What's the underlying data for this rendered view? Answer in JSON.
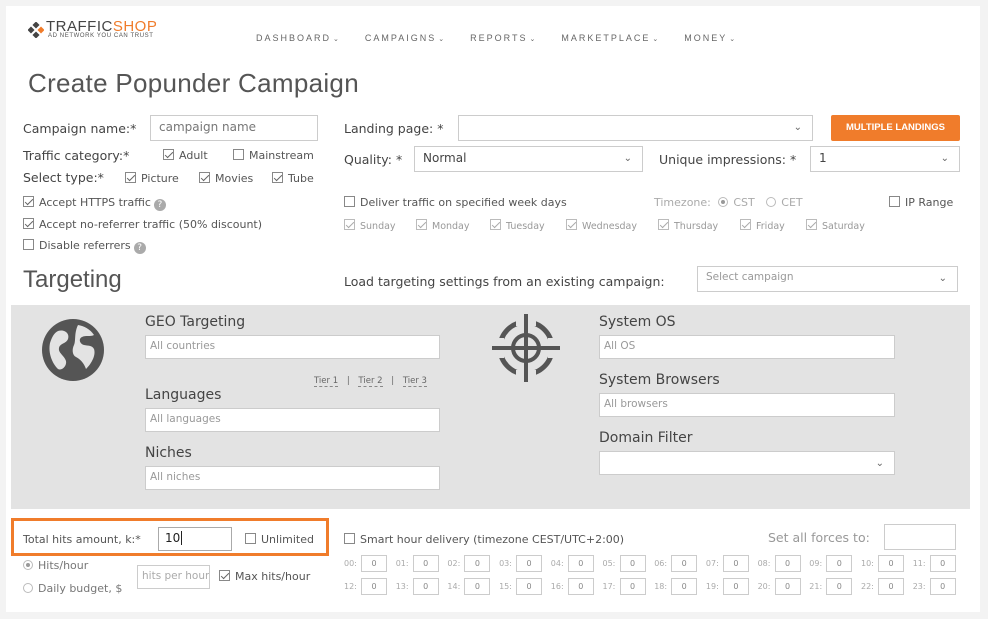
{
  "brand": {
    "name_part1": "TRAFFIC",
    "name_part2": "SHOP",
    "tagline": "AD NETWORK YOU CAN TRUST",
    "accent_color": "#f07c2b"
  },
  "nav": [
    {
      "label": "DASHBOARD",
      "icon": "chevron-down-icon"
    },
    {
      "label": "CAMPAIGNS",
      "icon": "chevron-down-icon"
    },
    {
      "label": "REPORTS",
      "icon": "chevron-down-icon"
    },
    {
      "label": "MARKETPLACE",
      "icon": "chevron-down-icon"
    },
    {
      "label": "MONEY",
      "icon": "chevron-down-icon"
    }
  ],
  "page_title": "Create Popunder Campaign",
  "form": {
    "campaign_name_label": "Campaign name:*",
    "campaign_name_placeholder": "campaign name",
    "landing_page_label": "Landing page: *",
    "landing_page_value": "",
    "multiple_landings_button": "MULTIPLE LANDINGS",
    "traffic_category_label": "Traffic category:*",
    "traffic_categories": [
      {
        "label": "Adult",
        "checked": true
      },
      {
        "label": "Mainstream",
        "checked": false
      }
    ],
    "quality_label": "Quality: *",
    "quality_value": "Normal",
    "unique_impressions_label": "Unique impressions: *",
    "unique_impressions_value": "1",
    "select_type_label": "Select type:*",
    "types": [
      {
        "label": "Picture",
        "checked": true
      },
      {
        "label": "Movies",
        "checked": true
      },
      {
        "label": "Tube",
        "checked": true
      }
    ],
    "accept_https": {
      "label": "Accept HTTPS traffic",
      "checked": true
    },
    "accept_noreferrer": {
      "label": "Accept no-referrer traffic (50% discount)",
      "checked": true
    },
    "disable_referrers": {
      "label": "Disable referrers",
      "checked": false
    },
    "deliver_week_days": {
      "label": "Deliver traffic on specified week days",
      "checked": false
    },
    "timezone_label": "Timezone:",
    "timezones": [
      {
        "label": "CST",
        "selected": true
      },
      {
        "label": "CET",
        "selected": false
      }
    ],
    "ip_range": {
      "label": "IP Range",
      "checked": false
    },
    "week_days": [
      {
        "label": "Sunday",
        "checked": true
      },
      {
        "label": "Monday",
        "checked": true
      },
      {
        "label": "Tuesday",
        "checked": true
      },
      {
        "label": "Wednesday",
        "checked": true
      },
      {
        "label": "Thursday",
        "checked": true
      },
      {
        "label": "Friday",
        "checked": true
      },
      {
        "label": "Saturday",
        "checked": true
      }
    ]
  },
  "targeting": {
    "heading": "Targeting",
    "load_label": "Load targeting settings from an existing campaign:",
    "load_placeholder": "Select campaign",
    "geo_label": "GEO Targeting",
    "geo_placeholder": "All countries",
    "tiers": [
      "Tier 1",
      "Tier 2",
      "Tier 3"
    ],
    "tier_separator": "|",
    "languages_label": "Languages",
    "languages_placeholder": "All languages",
    "niches_label": "Niches",
    "niches_placeholder": "All niches",
    "os_label": "System OS",
    "os_placeholder": "All OS",
    "browsers_label": "System Browsers",
    "browsers_placeholder": "All browsers",
    "domain_filter_label": "Domain Filter",
    "domain_filter_value": ""
  },
  "delivery": {
    "total_hits_label": "Total hits amount, k:*",
    "total_hits_value": "10",
    "unlimited_label": "Unlimited",
    "unlimited_checked": false,
    "rate_options": [
      {
        "label": "Hits/hour",
        "selected": true
      },
      {
        "label": "Daily budget, $",
        "selected": false
      }
    ],
    "hits_per_hour_placeholder": "hits per hour",
    "max_hits_label": "Max hits/hour",
    "max_hits_checked": true,
    "smart_hour_label": "Smart hour delivery (timezone CEST/UTC+2:00)",
    "smart_hour_checked": false,
    "set_all_forces_label": "Set all forces to:",
    "set_all_forces_value": "",
    "hours": [
      {
        "label": "00:",
        "value": "0"
      },
      {
        "label": "01:",
        "value": "0"
      },
      {
        "label": "02:",
        "value": "0"
      },
      {
        "label": "03:",
        "value": "0"
      },
      {
        "label": "04:",
        "value": "0"
      },
      {
        "label": "05:",
        "value": "0"
      },
      {
        "label": "06:",
        "value": "0"
      },
      {
        "label": "07:",
        "value": "0"
      },
      {
        "label": "08:",
        "value": "0"
      },
      {
        "label": "09:",
        "value": "0"
      },
      {
        "label": "10:",
        "value": "0"
      },
      {
        "label": "11:",
        "value": "0"
      },
      {
        "label": "12:",
        "value": "0"
      },
      {
        "label": "13:",
        "value": "0"
      },
      {
        "label": "14:",
        "value": "0"
      },
      {
        "label": "15:",
        "value": "0"
      },
      {
        "label": "16:",
        "value": "0"
      },
      {
        "label": "17:",
        "value": "0"
      },
      {
        "label": "18:",
        "value": "0"
      },
      {
        "label": "19:",
        "value": "0"
      },
      {
        "label": "20:",
        "value": "0"
      },
      {
        "label": "21:",
        "value": "0"
      },
      {
        "label": "22:",
        "value": "0"
      },
      {
        "label": "23:",
        "value": "0"
      }
    ]
  }
}
